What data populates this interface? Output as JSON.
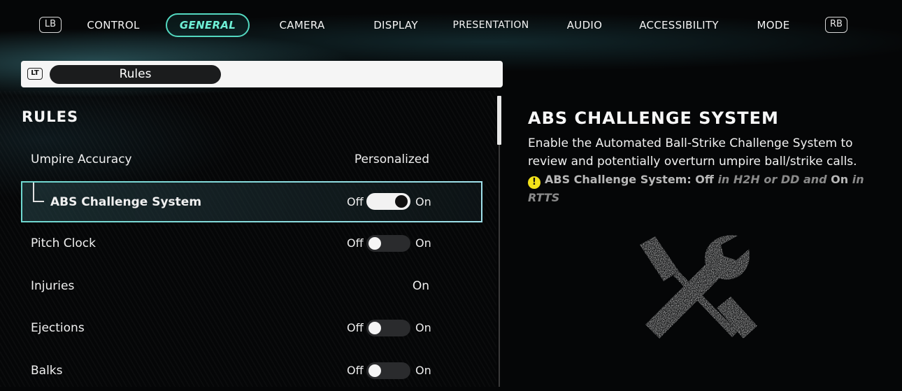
{
  "nav": {
    "left_bumper": "LB",
    "right_bumper": "RB",
    "tabs": [
      {
        "label": "CONTROL"
      },
      {
        "label": "GENERAL"
      },
      {
        "label": "CAMERA"
      },
      {
        "label": "DISPLAY"
      },
      {
        "label": "PRESENTATION"
      },
      {
        "label": "AUDIO"
      },
      {
        "label": "ACCESSIBILITY"
      },
      {
        "label": "MODE"
      }
    ],
    "active_tab": "GENERAL"
  },
  "rules_bar": {
    "badge": "LT",
    "label": "Rules"
  },
  "section": {
    "title": "RULES"
  },
  "rows": [
    {
      "label": "Umpire Accuracy",
      "value": "Personalized"
    },
    {
      "label": "ABS Challenge System",
      "off": "Off",
      "on": "On",
      "state": "on"
    },
    {
      "label": "Pitch Clock",
      "off": "Off",
      "on": "On",
      "state": "off"
    },
    {
      "label": "Injuries",
      "value": "On"
    },
    {
      "label": "Ejections",
      "off": "Off",
      "on": "On",
      "state": "off"
    },
    {
      "label": "Balks",
      "off": "Off",
      "on": "On",
      "state": "off"
    }
  ],
  "info": {
    "title": "ABS CHALLENGE SYSTEM",
    "description": "Enable the Automated Ball-Strike Challenge System to review and potentially overturn umpire ball/strike calls.",
    "note_prefix": "ABS Challenge System: Off",
    "note_mid": " in H2H or DD and ",
    "note_on": "On",
    "note_suffix": " in RTTS",
    "icon": "wrench-screwdriver-icon"
  },
  "colors": {
    "accent": "#53d8c0",
    "warning": "#f2e21a"
  }
}
